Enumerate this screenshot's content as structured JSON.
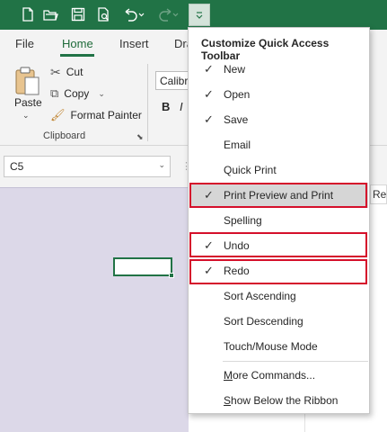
{
  "colors": {
    "title_bar": "#217346",
    "highlight_box": "#d5102b",
    "menu_hover": "#d6d6d6"
  },
  "qat": {
    "icons": [
      "new-file-icon",
      "open-folder-icon",
      "save-icon",
      "print-preview-icon",
      "undo-icon",
      "redo-icon",
      "customize-qat-icon"
    ]
  },
  "ribbon": {
    "tabs": [
      "File",
      "Home",
      "Insert",
      "Dra"
    ],
    "active_tab": "Home",
    "clipboard": {
      "paste": "Paste",
      "cut": "Cut",
      "copy": "Copy",
      "format_painter": "Format Painter",
      "group_label": "Clipboard"
    },
    "font": {
      "name": "Calibri",
      "bold": "B",
      "italic": "I"
    }
  },
  "formula_bar": {
    "name_box": "C5",
    "right_cut_text": "Re"
  },
  "menu": {
    "title": "Customize Quick Access Toolbar",
    "items": [
      {
        "label": "New",
        "checked": "✓"
      },
      {
        "label": "Open",
        "checked": "✓"
      },
      {
        "label": "Save",
        "checked": "✓"
      },
      {
        "label": "Email",
        "checked": ""
      },
      {
        "label": "Quick Print",
        "checked": ""
      },
      {
        "label": "Print Preview and Print",
        "checked": "✓"
      },
      {
        "label": "Spelling",
        "checked": ""
      },
      {
        "label": "Undo",
        "checked": "✓"
      },
      {
        "label": "Redo",
        "checked": "✓"
      },
      {
        "label": "Sort Ascending",
        "checked": ""
      },
      {
        "label": "Sort Descending",
        "checked": ""
      },
      {
        "label": "Touch/Mouse Mode",
        "checked": ""
      }
    ],
    "more_commands": {
      "accel": "M",
      "rest": "ore Commands..."
    },
    "show_below": {
      "accel": "S",
      "rest": "how Below the Ribbon"
    }
  }
}
